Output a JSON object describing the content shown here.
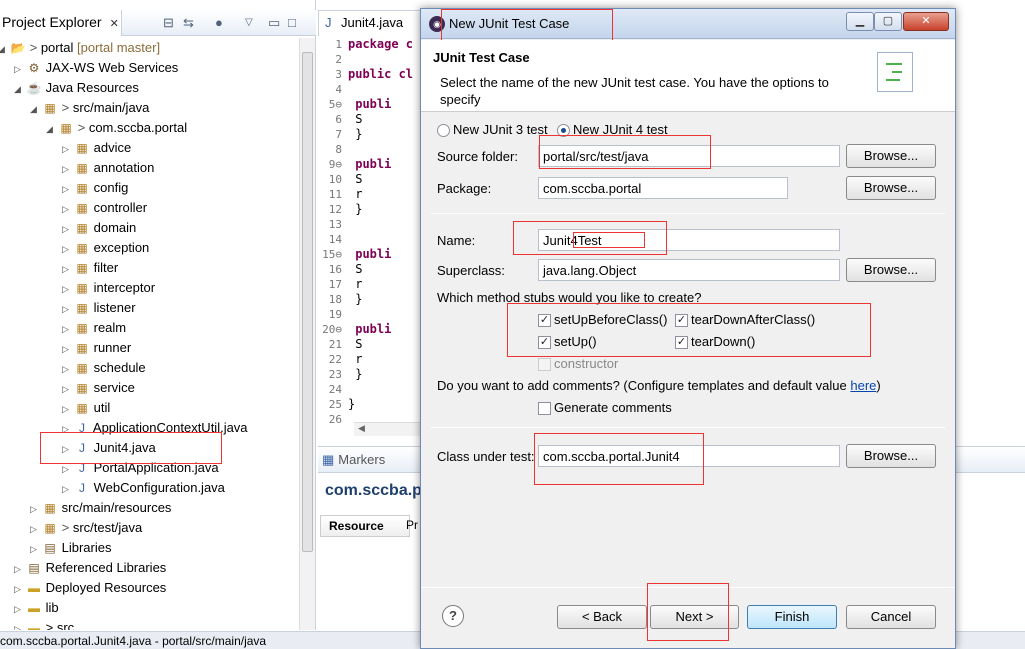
{
  "explorer": {
    "tab_label": "Project Explorer",
    "tab_close": "✕",
    "tree": [
      {
        "label": "portal",
        "decoration": "[portal master]",
        "prefix": "> ",
        "icon": "project-icon",
        "expanded": true,
        "depth": 0
      },
      {
        "label": "JAX-WS Web Services",
        "icon": "webservices-icon",
        "expanded": false,
        "depth": 1
      },
      {
        "label": "Java Resources",
        "icon": "java-resources-icon",
        "expanded": true,
        "depth": 1
      },
      {
        "label": "src/main/java",
        "prefix": "> ",
        "icon": "source-folder-icon",
        "expanded": true,
        "depth": 2
      },
      {
        "label": "com.sccba.portal",
        "prefix": "> ",
        "icon": "package-icon",
        "expanded": true,
        "depth": 3
      },
      {
        "label": "advice",
        "icon": "package-icon",
        "expanded": false,
        "depth": 4
      },
      {
        "label": "annotation",
        "icon": "package-icon",
        "expanded": false,
        "depth": 4
      },
      {
        "label": "config",
        "icon": "package-icon",
        "expanded": false,
        "depth": 4
      },
      {
        "label": "controller",
        "icon": "package-icon",
        "expanded": false,
        "depth": 4
      },
      {
        "label": "domain",
        "icon": "package-icon",
        "expanded": false,
        "depth": 4
      },
      {
        "label": "exception",
        "icon": "package-icon",
        "expanded": false,
        "depth": 4
      },
      {
        "label": "filter",
        "icon": "package-icon",
        "expanded": false,
        "depth": 4
      },
      {
        "label": "interceptor",
        "icon": "package-icon",
        "expanded": false,
        "depth": 4
      },
      {
        "label": "listener",
        "icon": "package-icon",
        "expanded": false,
        "depth": 4
      },
      {
        "label": "realm",
        "icon": "package-icon",
        "expanded": false,
        "depth": 4
      },
      {
        "label": "runner",
        "icon": "package-icon",
        "expanded": false,
        "depth": 4
      },
      {
        "label": "schedule",
        "icon": "package-icon",
        "expanded": false,
        "depth": 4
      },
      {
        "label": "service",
        "icon": "package-icon",
        "expanded": false,
        "depth": 4
      },
      {
        "label": "util",
        "icon": "package-icon",
        "expanded": false,
        "depth": 4
      },
      {
        "label": "ApplicationContextUtil.java",
        "icon": "java-file-icon",
        "expanded": false,
        "depth": 4
      },
      {
        "label": "Junit4.java",
        "icon": "java-file-icon",
        "expanded": false,
        "depth": 4
      },
      {
        "label": "PortalApplication.java",
        "icon": "java-file-icon",
        "expanded": false,
        "depth": 4
      },
      {
        "label": "WebConfiguration.java",
        "icon": "java-file-icon",
        "expanded": false,
        "depth": 4
      },
      {
        "label": "src/main/resources",
        "icon": "source-folder-icon",
        "expanded": false,
        "depth": 2
      },
      {
        "label": "src/test/java",
        "prefix": "> ",
        "icon": "source-folder-icon",
        "expanded": false,
        "depth": 2
      },
      {
        "label": "Libraries",
        "icon": "library-icon",
        "expanded": false,
        "depth": 2
      },
      {
        "label": "Referenced Libraries",
        "icon": "library-icon",
        "expanded": false,
        "depth": 1
      },
      {
        "label": "Deployed Resources",
        "icon": "folder-icon",
        "expanded": false,
        "depth": 1
      },
      {
        "label": "lib",
        "icon": "folder-icon",
        "expanded": false,
        "depth": 1
      },
      {
        "label": "> src",
        "icon": "folder-icon",
        "expanded": false,
        "depth": 1
      }
    ]
  },
  "editor": {
    "tab_label": "Junit4.java",
    "lines": [
      {
        "n": "1",
        "text": "package c",
        "kw": true
      },
      {
        "n": "2",
        "text": "",
        "kw": false
      },
      {
        "n": "3",
        "text": "public cl",
        "kw": true
      },
      {
        "n": "4",
        "text": "",
        "kw": false
      },
      {
        "n": "5⊖",
        "text": "    publi",
        "kw": true
      },
      {
        "n": "6",
        "text": "        S",
        "kw": false
      },
      {
        "n": "7",
        "text": "    }",
        "kw": false
      },
      {
        "n": "8",
        "text": "",
        "kw": false
      },
      {
        "n": "9⊖",
        "text": "    publi",
        "kw": true
      },
      {
        "n": "10",
        "text": "        S",
        "kw": false
      },
      {
        "n": "11",
        "text": "        r",
        "kw": false
      },
      {
        "n": "12",
        "text": "    }",
        "kw": false
      },
      {
        "n": "13",
        "text": "",
        "kw": false
      },
      {
        "n": "14",
        "text": "",
        "kw": false
      },
      {
        "n": "15⊖",
        "text": "    publi",
        "kw": true
      },
      {
        "n": "16",
        "text": "        S",
        "kw": false
      },
      {
        "n": "17",
        "text": "        r",
        "kw": false
      },
      {
        "n": "18",
        "text": "    }",
        "kw": false
      },
      {
        "n": "19",
        "text": "",
        "kw": false
      },
      {
        "n": "20⊖",
        "text": "    publi",
        "kw": true
      },
      {
        "n": "21",
        "text": "        S",
        "kw": false
      },
      {
        "n": "22",
        "text": "        r",
        "kw": false
      },
      {
        "n": "23",
        "text": "    }",
        "kw": false
      },
      {
        "n": "24",
        "text": "",
        "kw": false
      },
      {
        "n": "25",
        "text": "}",
        "kw": false
      },
      {
        "n": "26",
        "text": "",
        "kw": false
      }
    ]
  },
  "markers": {
    "tab_label": "Markers",
    "title": "com.sccba.p",
    "column_resource": "Resource",
    "column_pr": "Pr"
  },
  "statusbar": {
    "text": "com.sccba.portal.Junit4.java - portal/src/main/java"
  },
  "dialog": {
    "title": "New JUnit Test Case",
    "header_title": "JUnit Test Case",
    "header_desc": "Select the name of the new JUnit test case. You have the options to specify",
    "radio_junit3": "New JUnit 3 test",
    "radio_junit4": "New JUnit 4 test",
    "selected_version": "junit4",
    "source_folder_label": "Source folder:",
    "source_folder_value": "portal/src/test/java",
    "package_label": "Package:",
    "package_value": "com.sccba.portal",
    "name_label": "Name:",
    "name_value": "Junit4Test",
    "superclass_label": "Superclass:",
    "superclass_value": "java.lang.Object",
    "browse_label": "Browse...",
    "stubs_question": "Which method stubs would you like to create?",
    "stubs": {
      "setUpBeforeClass": {
        "label": "setUpBeforeClass()",
        "checked": true
      },
      "tearDownAfterClass": {
        "label": "tearDownAfterClass()",
        "checked": true
      },
      "setUp": {
        "label": "setUp()",
        "checked": true
      },
      "tearDown": {
        "label": "tearDown()",
        "checked": true
      },
      "constructor": {
        "label": "constructor",
        "checked": false
      }
    },
    "comments_question_pre": "Do you want to add comments? (Configure templates and default value ",
    "comments_link": "here",
    "comments_question_post": ")",
    "generate_comments_label": "Generate comments",
    "generate_comments_checked": false,
    "class_under_test_label": "Class under test:",
    "class_under_test_value": "com.sccba.portal.Junit4",
    "back_label": "< Back",
    "next_label": "Next >",
    "finish_label": "Finish",
    "cancel_label": "Cancel",
    "help_label": "?"
  },
  "colors": {
    "highlight_box": "#ee3333",
    "link": "#0645ad"
  }
}
